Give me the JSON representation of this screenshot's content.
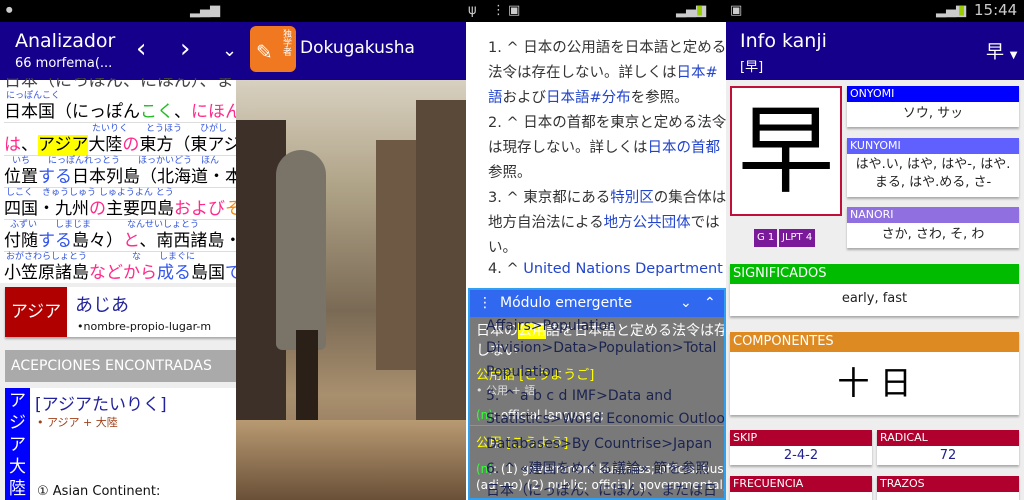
{
  "analizador": {
    "title": "Analizador",
    "subtitle": "66 morfema(...",
    "prev": "‹",
    "next": "›",
    "more": "⌄",
    "partial_top": "日本（にっぽん、にほん）、ま",
    "lines": [
      {
        "ruby": "にっぽんこく",
        "segs": [
          "日本国（にっぽん",
          "こく",
          "、",
          "にほん"
        ]
      },
      {
        "ruby": "たいりく　　とうほう　　ひがし",
        "segs": [
          "は",
          "、",
          "アジア",
          "大陸",
          "の",
          "東方（東アジ"
        ]
      },
      {
        "ruby": "いち　　にっぽんれっとう　　ほっかいどう　ほん",
        "segs": [
          "位置",
          "する",
          "日本列島（北海道・本"
        ]
      },
      {
        "ruby": "しこく　きゅうしゅう しゅようよん とう",
        "segs": [
          "四国・九州",
          "の",
          "主要四島",
          "および",
          "そ"
        ]
      },
      {
        "ruby": "ふずい　　しまじま　　　　なんせいしょとう",
        "segs": [
          "付随",
          "する",
          "島々）",
          "と",
          "、南西諸島・"
        ]
      },
      {
        "ruby": "おがさわらしょとう　　　　　な　　しまぐに",
        "segs": [
          "小笠原諸島",
          "などから",
          "成る",
          "島国",
          "で"
        ]
      }
    ],
    "entry": {
      "kana": "アジア",
      "reading": "あじあ",
      "meta": "•nombre-propio-lugar-m"
    },
    "acepciones": "ACEPCIONES ENCONTRADAS",
    "sense": {
      "vertical": "アジア大陸",
      "reading": "[アジアたいりく]",
      "parts": "• アジア + 大陸",
      "meaning": "① Asian Continent:"
    }
  },
  "dokugakusha": {
    "title": "Dokugakusha",
    "logo": "独学者"
  },
  "wiki": {
    "lines": [
      [
        "1. ^ 日本の公用語を日本語と定める",
        ""
      ],
      [
        "法令は存在しない。詳しくは",
        "日本#"
      ],
      [
        "語",
        "および",
        "日本語#分布",
        "を参照。"
      ],
      [
        "2. ^ 日本の首都を東京と定める法令",
        ""
      ],
      [
        "は現存しない。詳しくは",
        "日本の首都"
      ],
      [
        "参照。",
        ""
      ],
      [
        "3. ^ 東京都にある",
        "特別区",
        "の集合体は"
      ],
      [
        "地方自治法による",
        "地方公共団体",
        "では"
      ],
      [
        "い。",
        ""
      ],
      [
        "4. ^ ",
        "United Nations Department of"
      ]
    ],
    "behind": [
      "Affairs>Population",
      "Division>Data>Population>Total",
      "Population",
      "5. ^ a b c d  IMF>Data and",
      "Statistics>World Economic Outlook",
      "Databases>By Countrise>Japan",
      "6. ^ «建国をめぐる議論» 節を参照",
      "日本（にっぽん、にほん）、または日"
    ]
  },
  "popup": {
    "title": "Módulo emergente",
    "sentence_pre": "日本の",
    "sentence_hl": "公用",
    "sentence_post": "語を日本語と定める法令は存",
    "sentence2": "しない",
    "w1": "公用語 [こうようご]",
    "w1parts": "• 公用 + 語",
    "w1pos": "(n)",
    "w1def": ": official language;",
    "w2": "公用 [こうよう]",
    "w2pos": "(n)",
    "w2def": ": (1) government business; official business",
    "w2def2": "(adj-no) (2) public; official; governmental;"
  },
  "kanji": {
    "time": "15:44",
    "title": "Info kanji",
    "subtitle": "[早]",
    "selector": "早",
    "char": "早",
    "grade": "G 1",
    "jlpt": "JLPT 4",
    "onyomi_label": "ONYOMI",
    "onyomi": "ソウ, サッ",
    "kunyomi_label": "KUNYOMI",
    "kunyomi": "はや.い, はや, はや-, はや.まる, はや.める, さ-",
    "nanori_label": "NANORI",
    "nanori": "さか, さわ, そ, わ",
    "sig_label": "SIGNIFICADOS",
    "sig": "early, fast",
    "comp_label": "COMPONENTES",
    "comp": "十 日",
    "skip_label": "SKIP",
    "skip": "2-4-2",
    "radical_label": "RADICAL",
    "radical": "72",
    "freq_label": "FRECUENCIA",
    "trazos_label": "TRAZOS"
  },
  "colors": {
    "appbar": "#14008a",
    "onyomi": "#0000ff",
    "kunyomi": "#6060ff",
    "nanori": "#9070e0",
    "sig": "#00bb00",
    "comp": "#dd8a22",
    "red": "#b0002e"
  }
}
